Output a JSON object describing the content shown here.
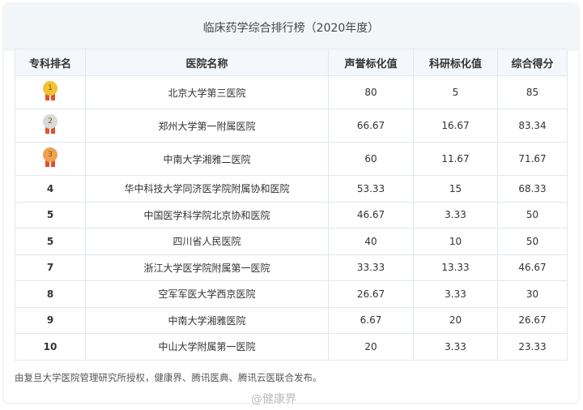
{
  "title": "临床药学综合排行榜（2020年度）",
  "headers": [
    "专科排名",
    "医院名称",
    "声誉标化值",
    "科研标化值",
    "综合得分"
  ],
  "rows": [
    {
      "rank": "1",
      "hospital": "北京大学第三医院",
      "reputation": "80",
      "research": "5",
      "total": "85",
      "medal": "gold"
    },
    {
      "rank": "2",
      "hospital": "郑州大学第一附属医院",
      "reputation": "66.67",
      "research": "16.67",
      "total": "83.34",
      "medal": "silver"
    },
    {
      "rank": "3",
      "hospital": "中南大学湘雅二医院",
      "reputation": "60",
      "research": "11.67",
      "total": "71.67",
      "medal": "bronze"
    },
    {
      "rank": "4",
      "hospital": "华中科技大学同济医学院附属协和医院",
      "reputation": "53.33",
      "research": "15",
      "total": "68.33"
    },
    {
      "rank": "5",
      "hospital": "中国医学科学院北京协和医院",
      "reputation": "46.67",
      "research": "3.33",
      "total": "50"
    },
    {
      "rank": "5",
      "hospital": "四川省人民医院",
      "reputation": "40",
      "research": "10",
      "total": "50"
    },
    {
      "rank": "7",
      "hospital": "浙江大学医学院附属第一医院",
      "reputation": "33.33",
      "research": "13.33",
      "total": "46.67"
    },
    {
      "rank": "8",
      "hospital": "空军军医大学西京医院",
      "reputation": "26.67",
      "research": "3.33",
      "total": "30"
    },
    {
      "rank": "9",
      "hospital": "中南大学湘雅医院",
      "reputation": "6.67",
      "research": "20",
      "total": "26.67"
    },
    {
      "rank": "10",
      "hospital": "中山大学附属第一医院",
      "reputation": "20",
      "research": "3.33",
      "total": "23.33"
    }
  ],
  "medal_colors": {
    "gold": "#f3c233",
    "silver": "#d9d9d9",
    "bronze": "#f0a050"
  },
  "footer": "由复旦大学医院管理研究所授权，健康界、腾讯医典、腾讯云医联合发布。",
  "watermark": "@健康界"
}
